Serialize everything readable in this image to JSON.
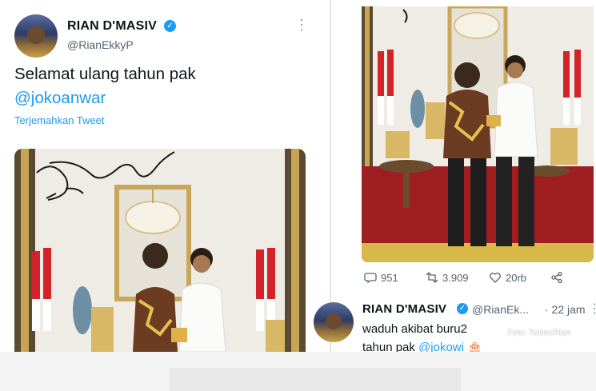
{
  "left_tweet": {
    "display_name": "RIAN D'MASIV",
    "handle": "@RianEkkyP",
    "text_line1": "Selamat ulang tahun pak",
    "mention": "@jokoanwar",
    "translate": "Terjemahkan Tweet",
    "more": "⋮",
    "verified_mark": "✓",
    "photo_icons": [
      "signature-icon",
      "chandelier-icon",
      "flag-icon"
    ]
  },
  "right_tweet": {
    "stats": {
      "replies": "951",
      "retweets": "3.909",
      "likes": "20rb"
    },
    "reply": {
      "display_name": "RIAN D'MASIV",
      "handle": "@RianEk...",
      "time": "· 22 jam",
      "more": "⋮",
      "verified_mark": "✓",
      "text_line1": "waduh akibat buru2",
      "text_line2_pre": "tahun pak ",
      "mention": "@jokowi",
      "emoji": "🎂"
    },
    "watermark": "Foto: Twitter/Rian"
  },
  "colors": {
    "accent": "#1d9bf0",
    "text": "#0f1419",
    "muted": "#536471"
  }
}
